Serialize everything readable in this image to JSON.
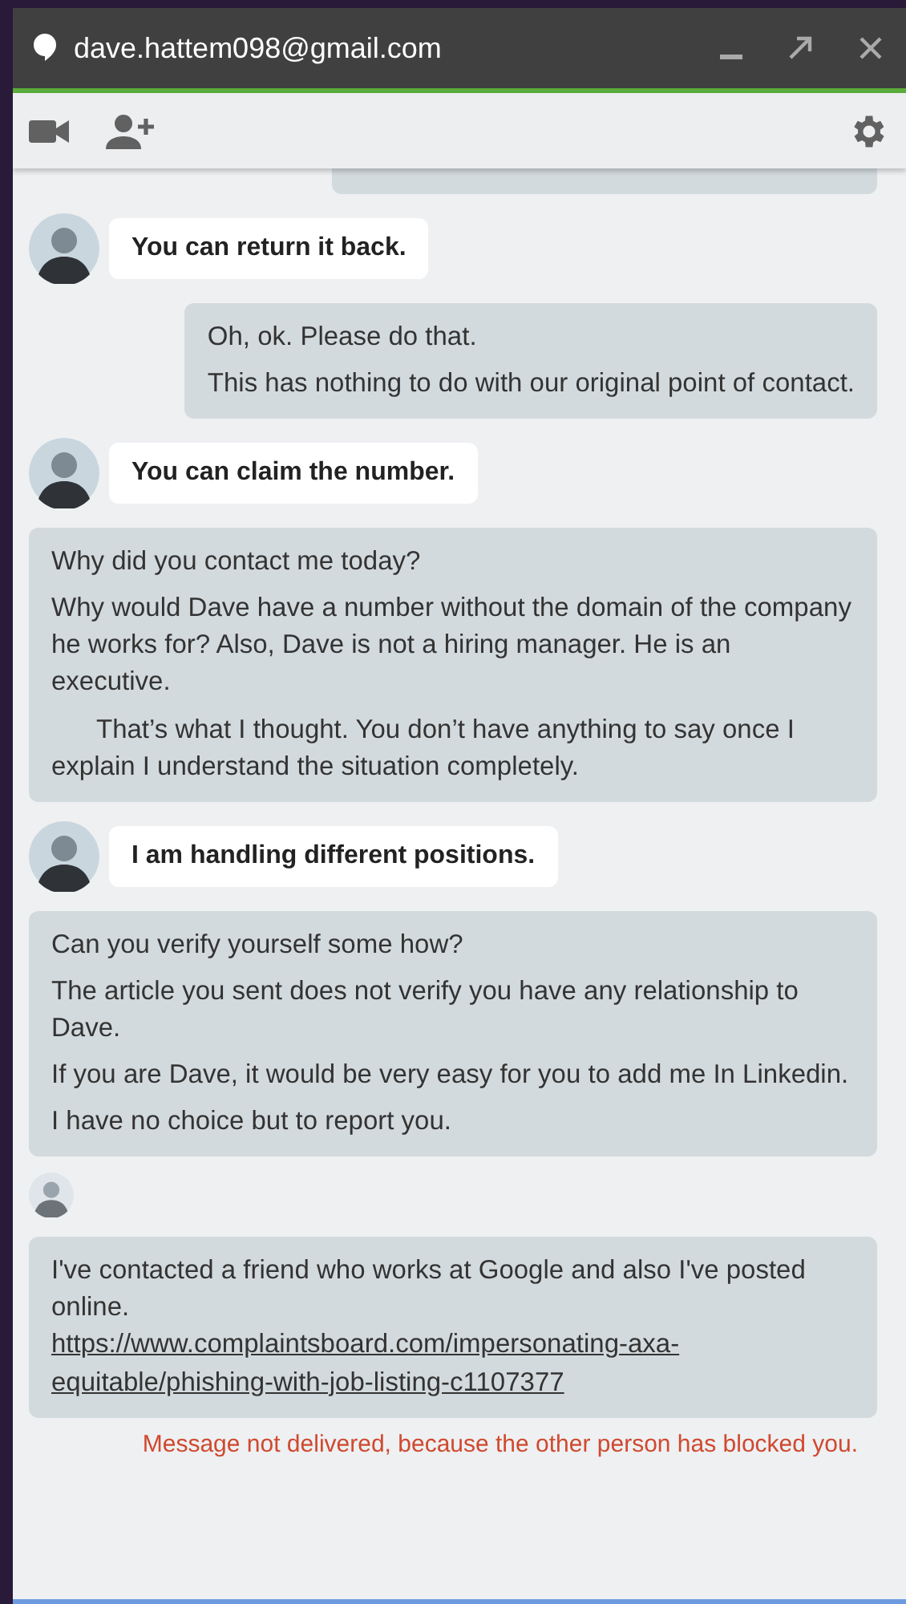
{
  "window": {
    "title": "dave.hattem098@gmail.com"
  },
  "messages": [
    {
      "kind": "clipped"
    },
    {
      "kind": "incoming",
      "text": "You can return it back."
    },
    {
      "kind": "outgoing",
      "paragraphs": [
        {
          "text": "Oh, ok. Please do that."
        },
        {
          "text": "This has nothing to do with our original point of contact."
        }
      ]
    },
    {
      "kind": "incoming",
      "text": "You can claim the number."
    },
    {
      "kind": "outgoing",
      "paragraphs": [
        {
          "text": "Why did you contact me today?"
        },
        {
          "text": "Why would Dave have a number without the domain of the company he works for? Also, Dave is not a hiring manager. He is an executive."
        },
        {
          "text": "That’s what I thought. You don’t have anything to say once I explain I understand the situation completely.",
          "indented": true
        }
      ]
    },
    {
      "kind": "incoming",
      "text": "I am handling different positions."
    },
    {
      "kind": "outgoing",
      "paragraphs": [
        {
          "text": "Can you verify yourself some how?"
        },
        {
          "text": "The article you sent does not verify you have any relationship to Dave."
        },
        {
          "text": "If you are Dave, it would be very easy for you to add me In Linkedin."
        },
        {
          "text": "I have no choice but to report you."
        }
      ]
    },
    {
      "kind": "avatar"
    },
    {
      "kind": "outgoing",
      "paragraphs": [
        {
          "text": "I've contacted a friend who works at Google and also I've posted"
        },
        {
          "text": "online.",
          "link": "https://www.complaintsboard.com/impersonating-axa-equitable/phishing-with-job-listing-c1107377"
        }
      ]
    },
    {
      "kind": "error",
      "text": "Message not delivered, because the other person has blocked you."
    }
  ]
}
